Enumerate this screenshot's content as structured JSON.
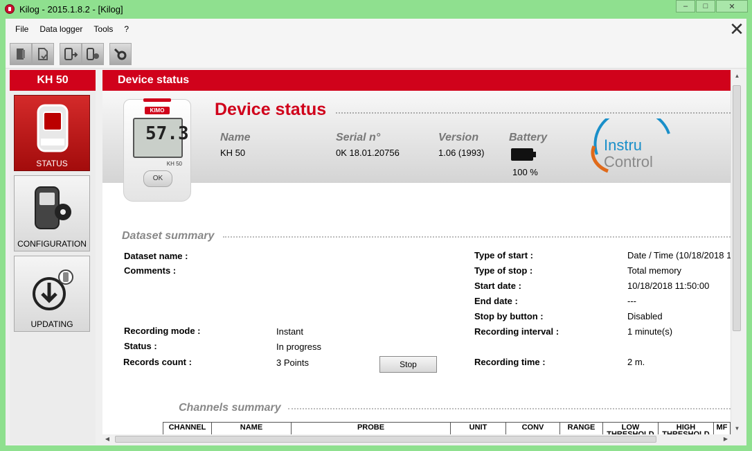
{
  "window": {
    "title": "Kilog - 2015.1.8.2 - [Kilog]",
    "minimize": "–",
    "maximize": "□",
    "close": "✕"
  },
  "menu": {
    "items": [
      "File",
      "Data logger",
      "Tools",
      "?"
    ],
    "app_close": "✕"
  },
  "toolbar": {
    "icons": [
      "open-file-icon",
      "save-file-icon",
      "download-icon",
      "configure-icon",
      "settings-icon"
    ]
  },
  "sidebar": {
    "device": "KH 50",
    "items": [
      {
        "label": "STATUS",
        "icon": "datalogger-icon",
        "active": true
      },
      {
        "label": "CONFIGURATION",
        "icon": "configuration-gear-icon",
        "active": false
      },
      {
        "label": "UPDATING",
        "icon": "download-update-icon",
        "active": false
      }
    ]
  },
  "main": {
    "header": "Device status",
    "device_status_title": "Device status",
    "device_image": {
      "brand": "KIMO",
      "reading": "57.3",
      "model": "KH 50",
      "button": "OK"
    },
    "info": {
      "name_label": "Name",
      "name_value": "KH 50",
      "serial_label": "Serial n°",
      "serial_value": "0K 18.01.20756",
      "version_label": "Version",
      "version_value": "1.06 (1993)",
      "battery_label": "Battery",
      "battery_value": "100 %"
    },
    "logo_text": "InstruControl",
    "dataset": {
      "title": "Dataset summary",
      "name_label": "Dataset name :",
      "comments_label": "Comments :",
      "recording_mode_label": "Recording mode :",
      "recording_mode_value": "Instant",
      "status_label": "Status :",
      "status_value": "In progress",
      "stop_button": "Stop",
      "records_count_label": "Records count :",
      "records_count_value": "3 Points",
      "type_start_label": "Type of start :",
      "type_start_value": "Date / Time (10/18/2018 1",
      "type_stop_label": "Type of stop :",
      "type_stop_value": "Total memory",
      "start_date_label": "Start date :",
      "start_date_value": "10/18/2018 11:50:00",
      "end_date_label": "End date :",
      "end_date_value": "---",
      "stop_by_button_label": "Stop by button :",
      "stop_by_button_value": "Disabled",
      "recording_interval_label": "Recording interval :",
      "recording_interval_value": "1 minute(s)",
      "recording_time_label": "Recording time :",
      "recording_time_value": "2 m."
    },
    "channels": {
      "title": "Channels summary",
      "columns": [
        "CHANNEL",
        "NAME",
        "PROBE",
        "UNIT",
        "CONV",
        "RANGE",
        "LOW THRESHOLD",
        "HIGH THRESHOLD",
        "MF"
      ]
    }
  },
  "colors": {
    "accent": "#d0021b",
    "frame": "#8fe08f"
  }
}
